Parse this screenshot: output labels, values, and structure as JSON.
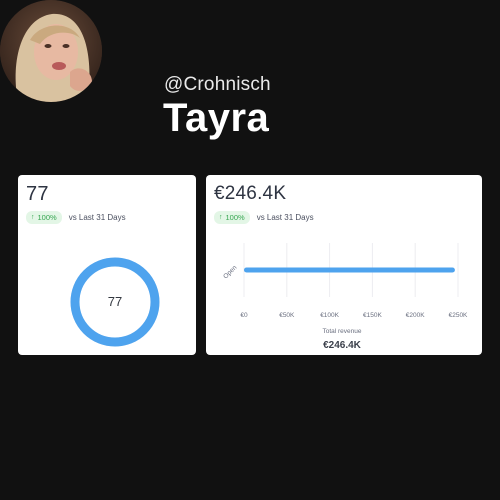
{
  "profile": {
    "handle": "@Crohnisch",
    "name": "Tayra"
  },
  "card_followers": {
    "value": "77",
    "trend_pct": "100%",
    "trend_text": "vs Last 31 Days",
    "ring_label": "77",
    "ring_fraction": 1.0,
    "ring_color": "#4ea3ee"
  },
  "card_revenue": {
    "value": "€246.4K",
    "trend_pct": "100%",
    "trend_text": "vs Last 31 Days",
    "footer_label": "Total revenue",
    "footer_value": "€246.4K"
  },
  "colors": {
    "background": "#111111",
    "card": "#ffffff",
    "accent_blue": "#4ea3ee",
    "trend_green": "#37a651"
  },
  "chart_data": {
    "type": "bar",
    "orientation": "horizontal",
    "categories": [
      "Open"
    ],
    "values": [
      246400
    ],
    "xlim": [
      0,
      250000
    ],
    "xticks": [
      0,
      50000,
      100000,
      150000,
      200000,
      250000
    ],
    "xtick_labels": [
      "€0",
      "€50K",
      "€100K",
      "€150K",
      "€200K",
      "€250K"
    ],
    "grid": true,
    "bar_color": "#4ea3ee"
  }
}
